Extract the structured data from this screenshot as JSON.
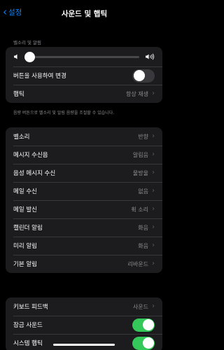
{
  "nav": {
    "back_label": "설정",
    "title": "사운드 및 햅틱"
  },
  "ringer": {
    "section_label": "벨소리 및 알림",
    "volume_level": 0.03,
    "change_with_buttons_label": "버튼을 사용하여 변경",
    "change_with_buttons_on": false,
    "haptics_label": "햅틱",
    "haptics_value": "항상 재생",
    "footnote": "음량 버튼으로 벨소리 및 알림 음량을 조절할 수 있습니다."
  },
  "sounds": [
    {
      "label": "벨소리",
      "value": "반향"
    },
    {
      "label": "메시지 수신음",
      "value": "알림음"
    },
    {
      "label": "음성 메시지 수신",
      "value": "물방울"
    },
    {
      "label": "메일 수신",
      "value": "없음"
    },
    {
      "label": "메일 발신",
      "value": "휙 소리"
    },
    {
      "label": "캘린더 알림",
      "value": "화음"
    },
    {
      "label": "미리 알림",
      "value": "화음"
    },
    {
      "label": "기본 알림",
      "value": "리바운드"
    }
  ],
  "system": {
    "keyboard_feedback_label": "키보드 피드백",
    "keyboard_feedback_value": "사운드",
    "lock_sound_label": "잠금 사운드",
    "lock_sound_on": true,
    "system_haptics_label": "시스템 햅틱",
    "system_haptics_on": true
  },
  "colors": {
    "accent": "#0a84ff",
    "toggle_on": "#34c759",
    "background": "#000000",
    "group": "#1c1c1e"
  }
}
